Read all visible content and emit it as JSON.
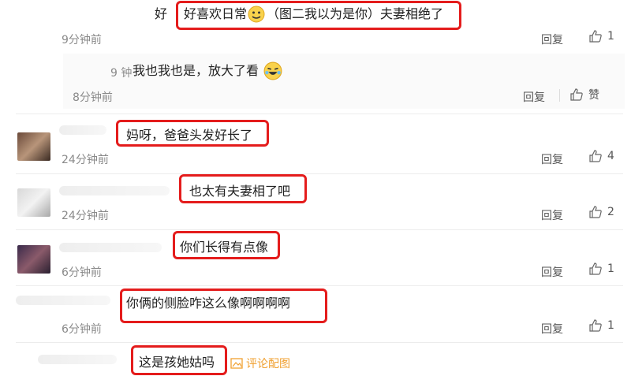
{
  "comments": [
    {
      "prefix": "好",
      "text": "好喜欢日常",
      "text2": "（图二我以为是你）夫妻相绝了",
      "time": "9分钟前",
      "reply": "回复",
      "likes": "1"
    },
    {
      "prefix": "9 钟",
      "text": "我也我也是，放大了看",
      "time": "8分钟前",
      "reply": "回复",
      "likes": "赞"
    },
    {
      "text": "妈呀，爸爸头发好长了",
      "time": "24分钟前",
      "reply": "回复",
      "likes": "4"
    },
    {
      "text": "也太有夫妻相了吧",
      "time": "24分钟前",
      "reply": "回复",
      "likes": "2"
    },
    {
      "text": "你们长得有点像",
      "time": "6分钟前",
      "reply": "回复",
      "likes": "1"
    },
    {
      "text": "你俩的侧脸咋这么像啊啊啊啊",
      "time": "6分钟前",
      "reply": "回复",
      "likes": "1"
    },
    {
      "text": "这是孩她姑吗",
      "link": "评论配图"
    }
  ],
  "colors": {
    "highlight": "#e41c1c",
    "link": "#f0a030"
  }
}
